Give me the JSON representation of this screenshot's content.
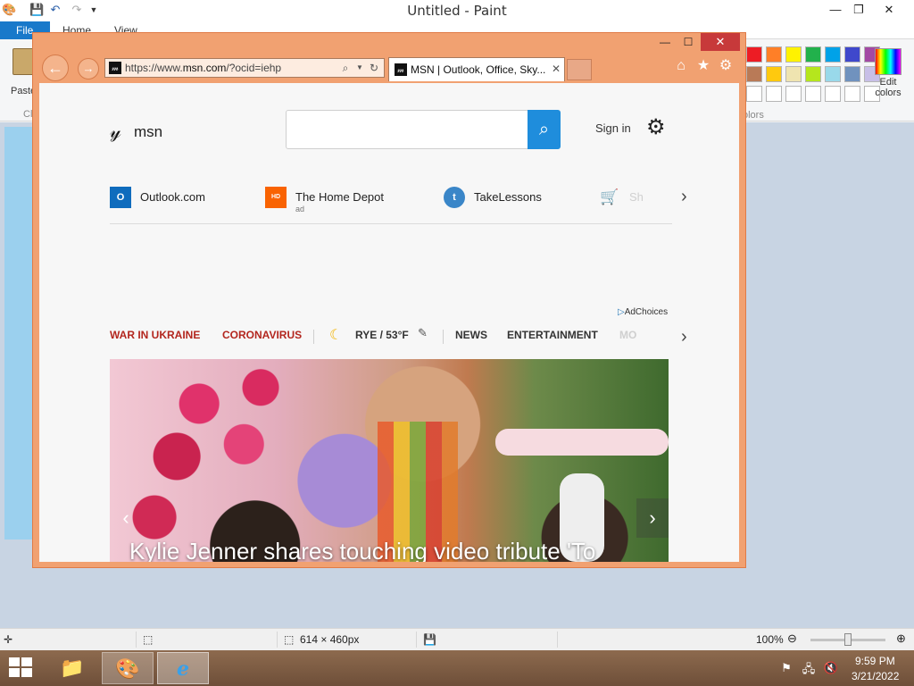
{
  "paint": {
    "title": "Untitled - Paint",
    "tabs": {
      "file": "File",
      "home": "Home",
      "view": "View"
    },
    "ribbon": {
      "paste_label": "Paste",
      "clipboard_label": "Cl",
      "edit_colors_label": "Edit colors",
      "colors_group_label": "olors",
      "palette": [
        "#ed1c24",
        "#ff7f27",
        "#fff200",
        "#22b14c",
        "#00a2e8",
        "#3f48cc",
        "#a349a4",
        "#b97a57",
        "#ffc90e",
        "#efe4b0",
        "#b5e61d",
        "#99d9ea",
        "#7092be",
        "#c8bfe7",
        "#ffffff",
        "#ffffff",
        "#ffffff",
        "#ffffff",
        "#ffffff",
        "#ffffff",
        "#ffffff"
      ]
    },
    "status": {
      "dimensions": "614 × 460px",
      "zoom": "100%"
    },
    "window_controls": {
      "minimize": "—",
      "restore": "❐",
      "close": "✕"
    }
  },
  "ie": {
    "address": {
      "prefix": "https://www.",
      "domain": "msn.com",
      "suffix": "/?ocid=iehp"
    },
    "tab_title": "MSN | Outlook, Office, Sky...",
    "window_controls": {
      "minimize": "—",
      "restore": "☐",
      "close": "✕"
    }
  },
  "msn": {
    "logo_text": "msn",
    "sign_in": "Sign in",
    "quick_links": [
      {
        "label": "Outlook.com",
        "sub": "",
        "icon": "outlook-icon",
        "color": "#0f6cbd"
      },
      {
        "label": "The Home Depot",
        "sub": "ad",
        "icon": "home-depot-icon",
        "color": "#f96302"
      },
      {
        "label": "TakeLessons",
        "sub": "",
        "icon": "takelessons-icon",
        "color": "#3a86c8"
      },
      {
        "label": "Sh",
        "sub": "",
        "icon": "shopping-cart-icon",
        "color": "#3a86c8"
      }
    ],
    "adchoices": "AdChoices",
    "nav": {
      "ukraine": "WAR IN UKRAINE",
      "coronavirus": "CORONAVIRUS",
      "weather": "RYE / 53°F",
      "news": "NEWS",
      "entertainment": "ENTERTAINMENT",
      "more": "MO"
    },
    "hero_headline": "Kylie Jenner shares touching video tribute 'To"
  },
  "taskbar": {
    "time": "9:59 PM",
    "date": "3/21/2022"
  }
}
